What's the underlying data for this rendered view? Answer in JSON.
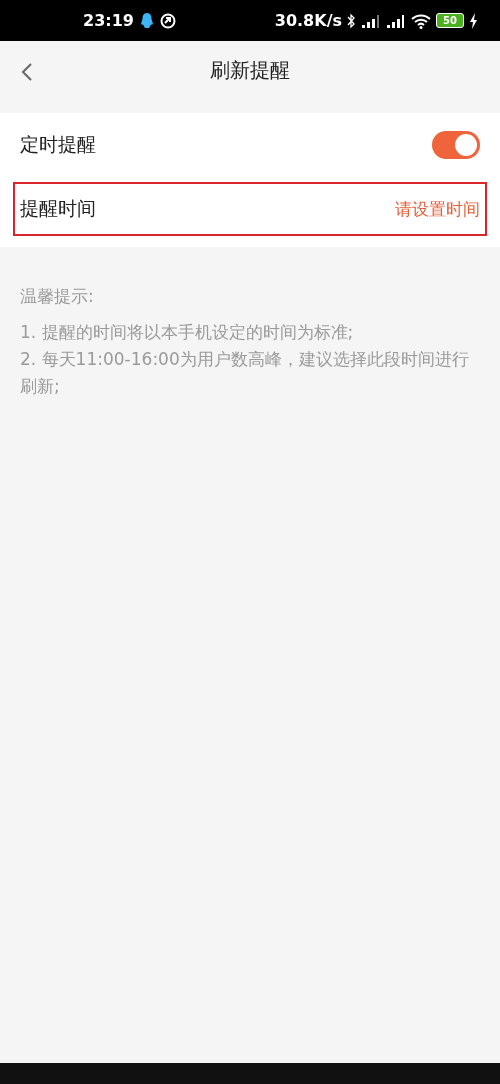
{
  "status_bar": {
    "time": "23:19",
    "network_speed": "30.8K/s",
    "battery": "50"
  },
  "header": {
    "title": "刷新提醒"
  },
  "settings": [
    {
      "kind": "toggle",
      "label": "定时提醒",
      "on": true,
      "highlighted": false
    },
    {
      "kind": "value",
      "label": "提醒时间",
      "value": "请设置时间",
      "highlighted": true
    }
  ],
  "tips": {
    "title": "温馨提示:",
    "items": [
      "1. 提醒的时间将以本手机设定的时间为标准;",
      "2. 每天11:00-16:00为用户数高峰，建议选择此段时间进行刷新;"
    ]
  }
}
